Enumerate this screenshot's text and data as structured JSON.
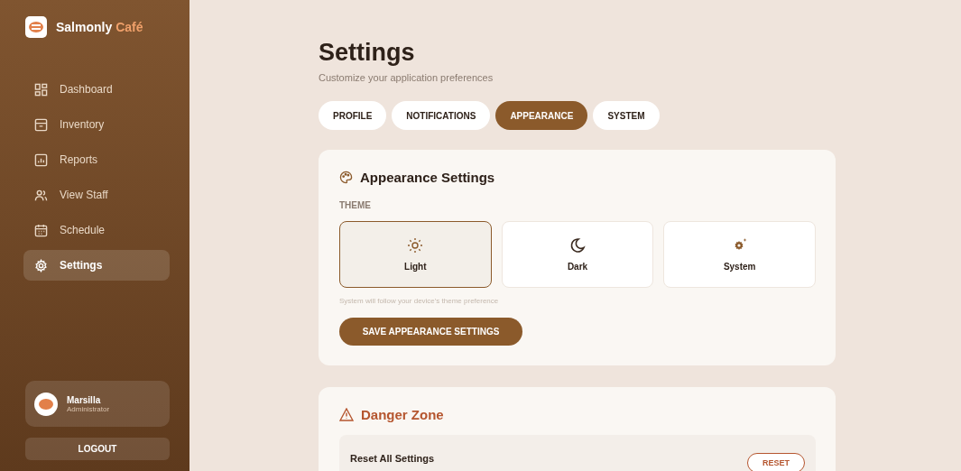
{
  "brand": {
    "name": "Salmonly",
    "accent": "Café"
  },
  "nav": [
    {
      "label": "Dashboard",
      "selected": false
    },
    {
      "label": "Inventory",
      "selected": false
    },
    {
      "label": "Reports",
      "selected": false
    },
    {
      "label": "View Staff",
      "selected": false
    },
    {
      "label": "Schedule",
      "selected": false
    },
    {
      "label": "Settings",
      "selected": true
    }
  ],
  "user": {
    "name": "Marsilla",
    "role": "Administrator"
  },
  "logout": "LOGOUT",
  "page": {
    "title": "Settings",
    "subtitle": "Customize your application preferences"
  },
  "tabs": [
    {
      "label": "PROFILE",
      "selected": false
    },
    {
      "label": "NOTIFICATIONS",
      "selected": false
    },
    {
      "label": "APPEARANCE",
      "selected": true
    },
    {
      "label": "SYSTEM",
      "selected": false
    }
  ],
  "appearance": {
    "title": "Appearance Settings",
    "theme_label": "THEME",
    "themes": [
      {
        "label": "Light",
        "selected": true
      },
      {
        "label": "Dark",
        "selected": false
      },
      {
        "label": "System",
        "selected": false
      }
    ],
    "hint": "System will follow your device's theme preference",
    "save": "SAVE APPEARANCE SETTINGS"
  },
  "danger": {
    "title": "Danger Zone",
    "item": "Reset All Settings",
    "button": "RESET"
  }
}
